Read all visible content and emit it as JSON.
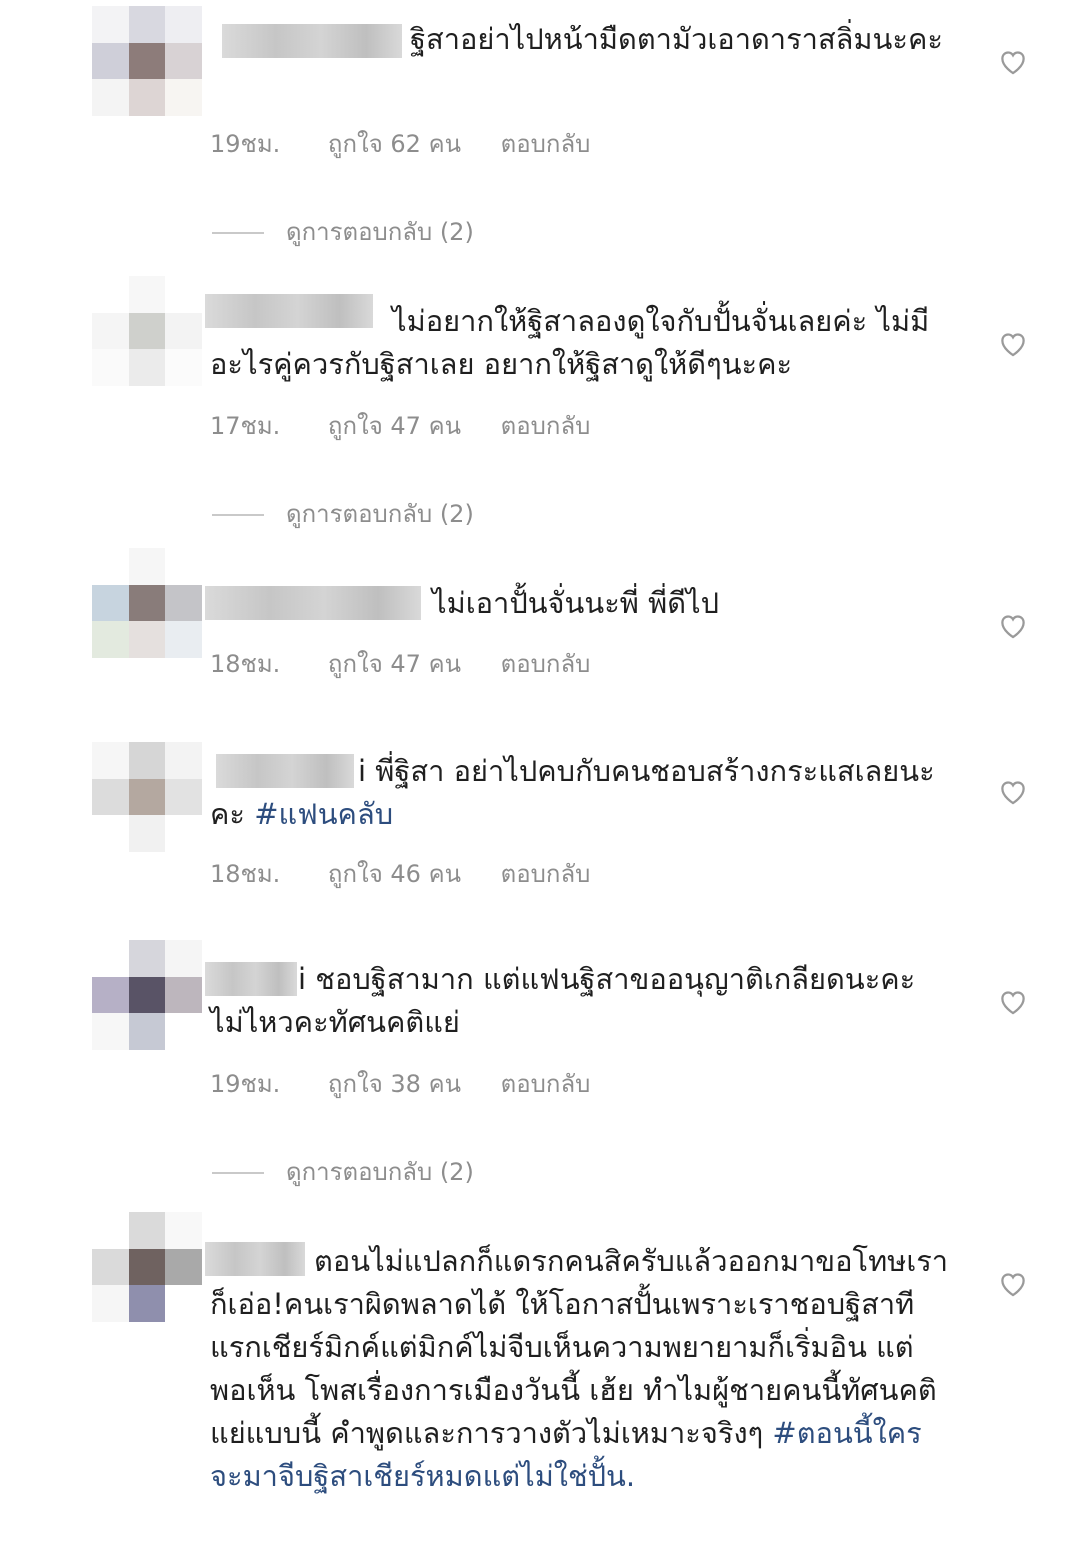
{
  "comments": [
    {
      "text": "ฐิสาอย่าไปหน้ามืดตามัวเอาดาราสลิ่มนะคะ",
      "time": "19ชม.",
      "likes": "ถูกใจ 62 คน",
      "reply": "ตอบกลับ",
      "view_replies": "ดูการตอบกลับ (2)"
    },
    {
      "text": "ไม่อยากให้ฐิสาลองดูใจกับปั้นจั่นเลยค่ะ ไม่มีอะไรคู่ควรกับฐิสาเลย อยากให้ฐิสาดูให้ดีๆนะคะ",
      "time": "17ชม.",
      "likes": "ถูกใจ 47 คน",
      "reply": "ตอบกลับ",
      "view_replies": "ดูการตอบกลับ (2)"
    },
    {
      "text": "ไม่เอาปั้นจั่นนะพี่ พี่ดีไป",
      "time": "18ชม.",
      "likes": "ถูกใจ 47 คน",
      "reply": "ตอบกลับ"
    },
    {
      "text": "i พี่ฐิสา อย่าไปคบกับคนชอบสร้างกระแสเลยนะคะ",
      "tag": "#แฟนคลับ",
      "time": "18ชม.",
      "likes": "ถูกใจ 46 คน",
      "reply": "ตอบกลับ"
    },
    {
      "text": "i ชอบฐิสามาก แต่แฟนฐิสาขออนุญาติเกลียดนะคะ ไม่ไหวคะทัศนคติแย่",
      "time": "19ชม.",
      "likes": "ถูกใจ 38 คน",
      "reply": "ตอบกลับ",
      "view_replies": "ดูการตอบกลับ (2)"
    },
    {
      "text": "ตอนไม่แปลกก็แดรกคนสิครับแล้วออกมาขอโทษเราก็เอ่อ!คนเราผิดพลาดได้ ให้โอกาสปั้นเพราะเราชอบฐิสาทีแรกเชียร์มิกค์แต่มิกค์ไม่จีบเห็นความพยายามก็เริ่มอิน แต่พอเห็น โพสเรื่องการเมืองวันนี้ เฮ้ย ทำไมผู้ชายคนนี้ทัศนคติแย่แบบนี้ คำพูดและการวางตัวไม่เหมาะจริงๆ",
      "tag": "#ตอนนี้ใครจะมาจีบฐิสาเชียร์หมดแต่ไม่ใช่ปั้น."
    }
  ],
  "icons": {
    "like": "heart-outline-icon"
  },
  "colors": {
    "meta_gray": "#8d8d8d",
    "hashtag_blue": "#2d4d7e"
  }
}
